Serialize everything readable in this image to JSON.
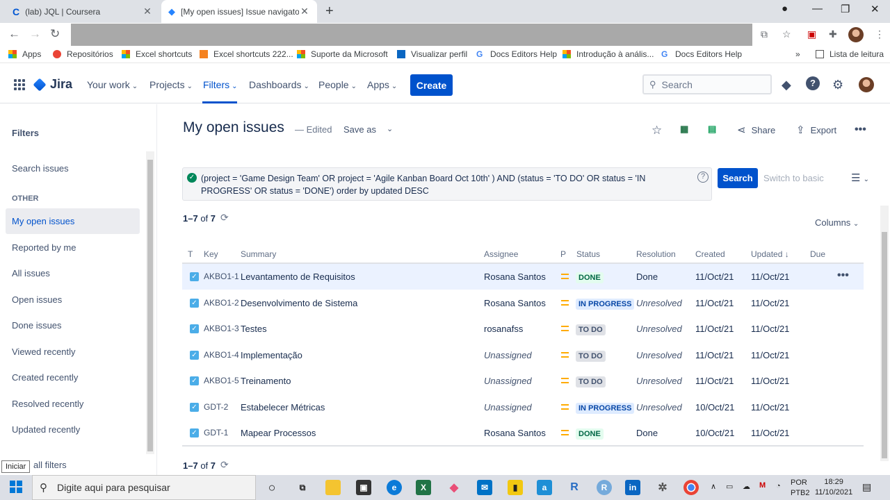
{
  "browser": {
    "tabs": [
      {
        "title": "(lab) JQL | Coursera",
        "active": false
      },
      {
        "title": "[My open issues] Issue navigator",
        "active": true
      }
    ],
    "bookmarks": [
      "Apps",
      "Repositórios",
      "Excel shortcuts",
      "Excel shortcuts 222...",
      "Suporte da Microsoft",
      "Visualizar perfil",
      "Docs Editors Help",
      "Introdução à anális...",
      "Docs Editors Help"
    ],
    "reading_list": "Lista de leitura"
  },
  "jira_nav": {
    "logo": "Jira",
    "items": [
      "Your work",
      "Projects",
      "Filters",
      "Dashboards",
      "People",
      "Apps"
    ],
    "active_item": "Filters",
    "create": "Create",
    "search_placeholder": "Search"
  },
  "sidebar": {
    "heading": "Filters",
    "search_issues": "Search issues",
    "section": "OTHER",
    "items": [
      "My open issues",
      "Reported by me",
      "All issues",
      "Open issues",
      "Done issues",
      "Viewed recently",
      "Created recently",
      "Resolved recently",
      "Updated recently"
    ],
    "selected": "My open issues",
    "view_all": "all filters",
    "tooltip": "Iniciar"
  },
  "header": {
    "title": "My open issues",
    "edited": "— Edited",
    "save_as": "Save as",
    "share": "Share",
    "export": "Export"
  },
  "jql": {
    "query": "(project = 'Game Design Team' OR project = 'Agile Kanban Board Oct 10th' ) AND (status = 'TO DO' OR status = 'IN PROGRESS' OR status = 'DONE') order by updated DESC",
    "search_button": "Search",
    "switch_basic": "Switch to basic"
  },
  "results": {
    "range": "1–7",
    "of": "of",
    "total": "7",
    "columns_button": "Columns"
  },
  "table": {
    "headers": [
      "T",
      "Key",
      "Summary",
      "Assignee",
      "P",
      "Status",
      "Resolution",
      "Created",
      "Updated",
      "Due"
    ],
    "rows": [
      {
        "key": "AKBO1-1",
        "summary": "Levantamento de Requisitos",
        "assignee": "Rosana Santos",
        "status": "DONE",
        "resolution": "Done",
        "created": "11/Oct/21",
        "updated": "11/Oct/21"
      },
      {
        "key": "AKBO1-2",
        "summary": "Desenvolvimento de Sistema",
        "assignee": "Rosana Santos",
        "status": "IN PROGRESS",
        "resolution": "Unresolved",
        "created": "11/Oct/21",
        "updated": "11/Oct/21"
      },
      {
        "key": "AKBO1-3",
        "summary": "Testes",
        "assignee": "rosanafss",
        "status": "TO DO",
        "resolution": "Unresolved",
        "created": "11/Oct/21",
        "updated": "11/Oct/21"
      },
      {
        "key": "AKBO1-4",
        "summary": "Implementação",
        "assignee": "Unassigned",
        "status": "TO DO",
        "resolution": "Unresolved",
        "created": "11/Oct/21",
        "updated": "11/Oct/21"
      },
      {
        "key": "AKBO1-5",
        "summary": "Treinamento",
        "assignee": "Unassigned",
        "status": "TO DO",
        "resolution": "Unresolved",
        "created": "11/Oct/21",
        "updated": "11/Oct/21"
      },
      {
        "key": "GDT-2",
        "summary": "Estabelecer Métricas",
        "assignee": "Unassigned",
        "status": "IN PROGRESS",
        "resolution": "Unresolved",
        "created": "10/Oct/21",
        "updated": "11/Oct/21"
      },
      {
        "key": "GDT-1",
        "summary": "Mapear Processos",
        "assignee": "Rosana Santos",
        "status": "DONE",
        "resolution": "Done",
        "created": "10/Oct/21",
        "updated": "11/Oct/21"
      }
    ]
  },
  "taskbar": {
    "search_placeholder": "Digite aqui para pesquisar",
    "lang": "POR",
    "layout": "PTB2",
    "time": "18:29",
    "date": "11/10/2021"
  },
  "colors": {
    "brand": "#0052cc",
    "done": "#006644",
    "in_progress": "#0747a6",
    "todo": "#42526e"
  }
}
